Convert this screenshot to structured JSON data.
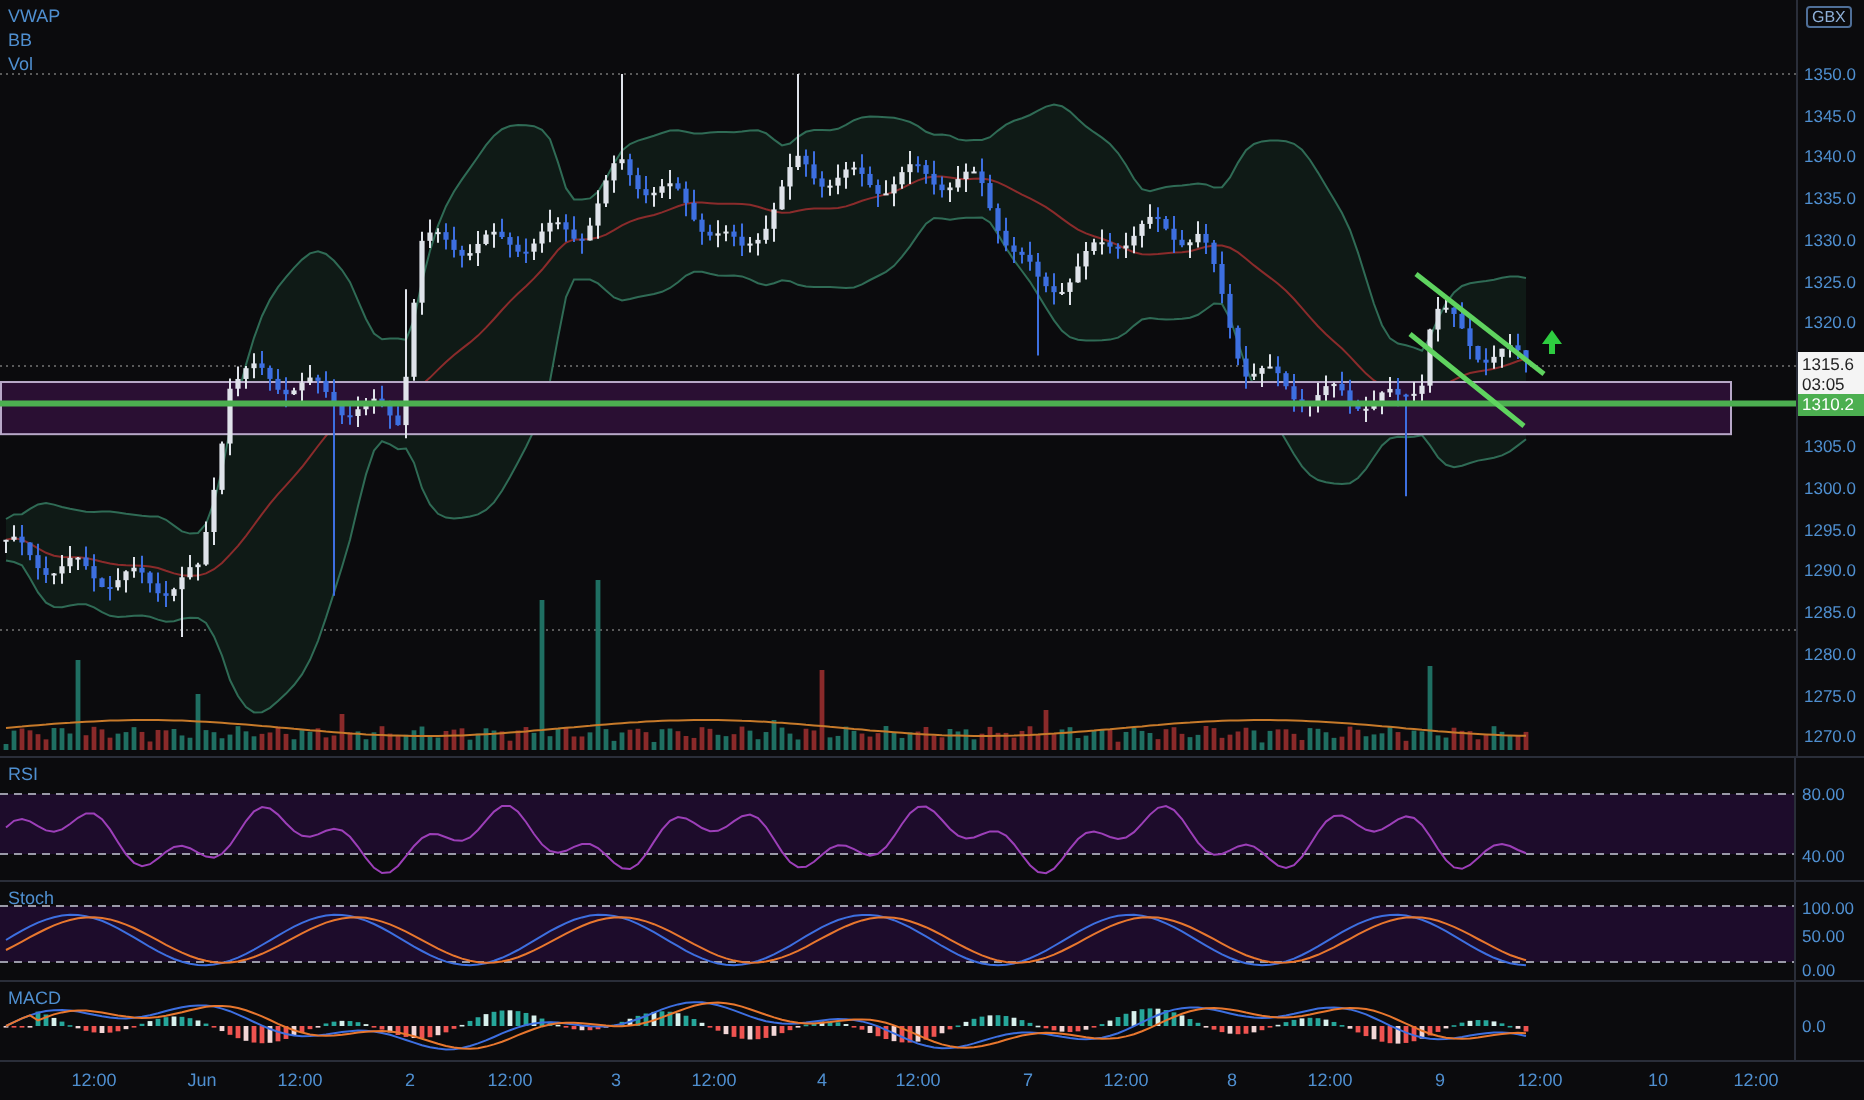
{
  "legend": [
    {
      "label": "VWAP"
    },
    {
      "label": "BB"
    },
    {
      "label": "Vol"
    }
  ],
  "price_axis": {
    "currency": "GBX",
    "labels": [
      "1350.0",
      "1345.0",
      "1340.0",
      "1335.0",
      "1330.0",
      "1325.0",
      "1320.0",
      "1305.0",
      "1300.0",
      "1295.0",
      "1290.0",
      "1285.0",
      "1280.0",
      "1275.0",
      "1270.0"
    ]
  },
  "last_price": {
    "price": "1315.6",
    "countdown": "03:05"
  },
  "level_line": {
    "price": "1310.2"
  },
  "panes": [
    {
      "kind": "rsi",
      "title": "RSI",
      "axis_labels": [
        "80.00",
        "40.00"
      ]
    },
    {
      "kind": "stoch",
      "title": "Stoch",
      "axis_labels": [
        "100.00",
        "50.00",
        "0.00"
      ]
    },
    {
      "kind": "macd",
      "title": "MACD",
      "axis_labels": [
        "0.0"
      ]
    }
  ],
  "time_axis": [
    "12:00",
    "Jun",
    "12:00",
    "2",
    "12:00",
    "3",
    "12:00",
    "4",
    "12:00",
    "7",
    "12:00",
    "8",
    "12:00",
    "9",
    "12:00",
    "10",
    "12:00"
  ]
}
